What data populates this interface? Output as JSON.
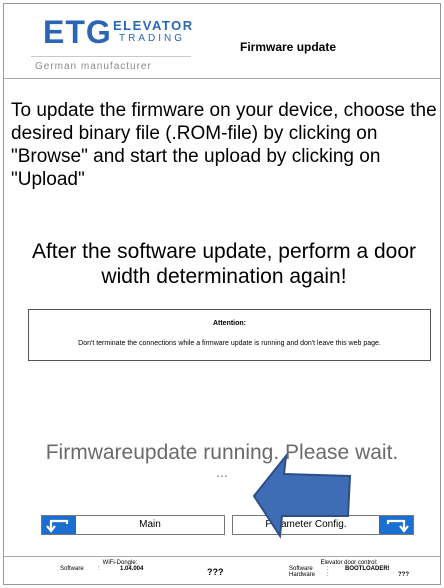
{
  "header": {
    "logo_main": "ETG",
    "logo_line1": "ELEVATOR",
    "logo_line2": "TRADING",
    "logo_sub": "German manufacturer",
    "title": "Firmware update"
  },
  "content": {
    "intro": "To update the firmware on your device, choose the desired binary file (.ROM-file) by clicking on \"Browse\" and start the upload by clicking on \"Upload\"",
    "warning": "After the software update, perform a door width determination again!",
    "attention_title": "Attention:",
    "attention_text": "Don't terminate the connections while a firmware update is running and don't leave this web page.",
    "status": "Firmwareupdate running. Please wait.",
    "dots": "..."
  },
  "nav": {
    "main_label": "Main",
    "param_label": "Parameter Config."
  },
  "footer": {
    "wifi_title": "WiFi-Dongle:",
    "wifi_software_label": "Software",
    "wifi_software_value": "1.04.004",
    "center": "???",
    "door_title": "Elevator door control:",
    "door_software_label": "Software",
    "door_software_value": "BOOTLOADER!",
    "door_hardware_label": "Hardware",
    "door_hardware_value": "???"
  },
  "colors": {
    "brand": "#2a66b3",
    "button_icon": "#1b6fd0",
    "arrow": "#3f6db5"
  }
}
